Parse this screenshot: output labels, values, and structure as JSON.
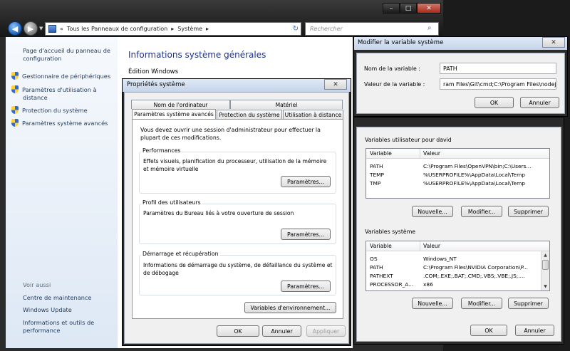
{
  "control_panel": {
    "breadcrumb_prefix": "«",
    "breadcrumb": [
      "Tous les Panneaux de configuration",
      "Système"
    ],
    "breadcrumb_sep": "▸",
    "search_placeholder": "Rechercher",
    "sidebar_home": "Page d'accueil du panneau de configuration",
    "sidebar_links": [
      "Gestionnaire de périphériques",
      "Paramètres d'utilisation à distance",
      "Protection du système",
      "Paramètres système avancés"
    ],
    "see_also_title": "Voir aussi",
    "see_also_links": [
      "Centre de maintenance",
      "Windows Update",
      "Informations et outils de performance"
    ],
    "heading": "Informations système générales",
    "edition_label": "Édition Windows",
    "window_buttons": {
      "minimize": "–",
      "maximize": "□",
      "close": "✕"
    }
  },
  "system_properties": {
    "title": "Propriétés système",
    "close": "✕",
    "tabs_back": [
      "Nom de l'ordinateur",
      "Matériel"
    ],
    "tabs_front": [
      "Paramètres système avancés",
      "Protection du système",
      "Utilisation à distance"
    ],
    "note": "Vous devez ouvrir une session d'administrateur pour effectuer la plupart de ces modifications.",
    "groups": [
      {
        "title": "Performances",
        "text": "Effets visuels, planification du processeur, utilisation de la mémoire et mémoire virtuelle",
        "button": "Paramètres..."
      },
      {
        "title": "Profil des utilisateurs",
        "text": "Paramètres du Bureau liés à votre ouverture de session",
        "button": "Paramètres..."
      },
      {
        "title": "Démarrage et récupération",
        "text": "Informations de démarrage du système, de défaillance du système et de débogage",
        "button": "Paramètres..."
      }
    ],
    "env_button": "Variables d'environnement...",
    "ok": "OK",
    "cancel": "Annuler",
    "apply": "Appliquer"
  },
  "env_vars": {
    "user_section": "Variables utilisateur pour david",
    "system_section": "Variables système",
    "col_variable": "Variable",
    "col_value": "Valeur",
    "user_vars": [
      {
        "name": "PATH",
        "value": "C:\\Program Files\\OpenVPN\\bin;C:\\Users..."
      },
      {
        "name": "TEMP",
        "value": "%USERPROFILE%\\AppData\\Local\\Temp"
      },
      {
        "name": "TMP",
        "value": "%USERPROFILE%\\AppData\\Local\\Temp"
      }
    ],
    "system_vars": [
      {
        "name": "OS",
        "value": "Windows_NT"
      },
      {
        "name": "PATH",
        "value": "C:\\Program Files\\NVIDIA Corporation\\P..."
      },
      {
        "name": "PATHEXT",
        "value": ".COM;.EXE;.BAT;.CMD;.VBS;.VBE;.JS;...."
      },
      {
        "name": "PROCESSOR_A...",
        "value": "x86"
      }
    ],
    "new_button": "Nouvelle...",
    "edit_button": "Modifier...",
    "delete_button": "Supprimer",
    "ok": "OK",
    "cancel": "Annuler"
  },
  "edit_variable": {
    "title": "Modifier la variable système",
    "close": "✕",
    "name_label": "Nom de la variable :",
    "name_value": "PATH",
    "value_label": "Valeur de la variable :",
    "value_value": "ram Files\\Git\\cmd;C:\\Program Files\\nodejs\\",
    "ok": "OK",
    "cancel": "Annuler"
  }
}
